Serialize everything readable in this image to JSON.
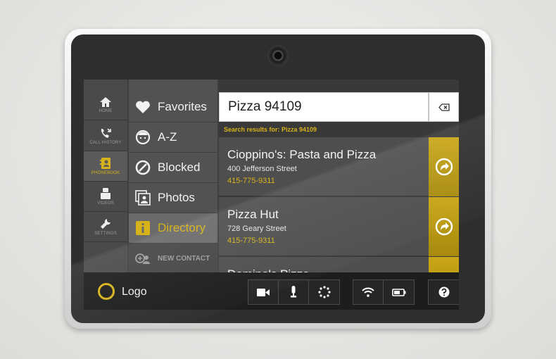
{
  "rail": [
    {
      "label": "HOME",
      "icon": "home-icon"
    },
    {
      "label": "CALL HISTORY",
      "icon": "call-history-icon"
    },
    {
      "label": "PHONEBOOK",
      "icon": "phonebook-icon",
      "active": true
    },
    {
      "label": "VIDEOS",
      "icon": "video-icon"
    },
    {
      "label": "SETTINGS",
      "icon": "settings-icon"
    }
  ],
  "menu": [
    {
      "label": "Favorites",
      "icon": "heart-icon"
    },
    {
      "label": "A-Z",
      "icon": "person-icon"
    },
    {
      "label": "Blocked",
      "icon": "blocked-icon"
    },
    {
      "label": "Photos",
      "icon": "photos-icon"
    },
    {
      "label": "Directory",
      "icon": "info-icon",
      "active": true
    },
    {
      "label": "NEW CONTACT",
      "icon": "new-contact-icon"
    }
  ],
  "search": {
    "value": "Pizza 94109",
    "caption": "Search results for: Pizza 94109"
  },
  "results": [
    {
      "name": "Cioppino's: Pasta and Pizza",
      "address": "400 Jefferson Street",
      "phone": "415-775-9311"
    },
    {
      "name": "Pizza Hut",
      "address": "728 Geary Street",
      "phone": "415-775-9311"
    },
    {
      "name": "Domino's Pizza",
      "address": "",
      "phone": ""
    }
  ],
  "bottom": {
    "logo": "Logo",
    "controls": [
      "video-camera-icon",
      "microphone-icon",
      "loading-icon"
    ],
    "status": [
      "wifi-icon",
      "battery-icon"
    ],
    "help": "help-icon"
  },
  "colors": {
    "accent": "#d7b21a",
    "panel": "#4e4e4e",
    "bar": "#1d1d1d"
  }
}
